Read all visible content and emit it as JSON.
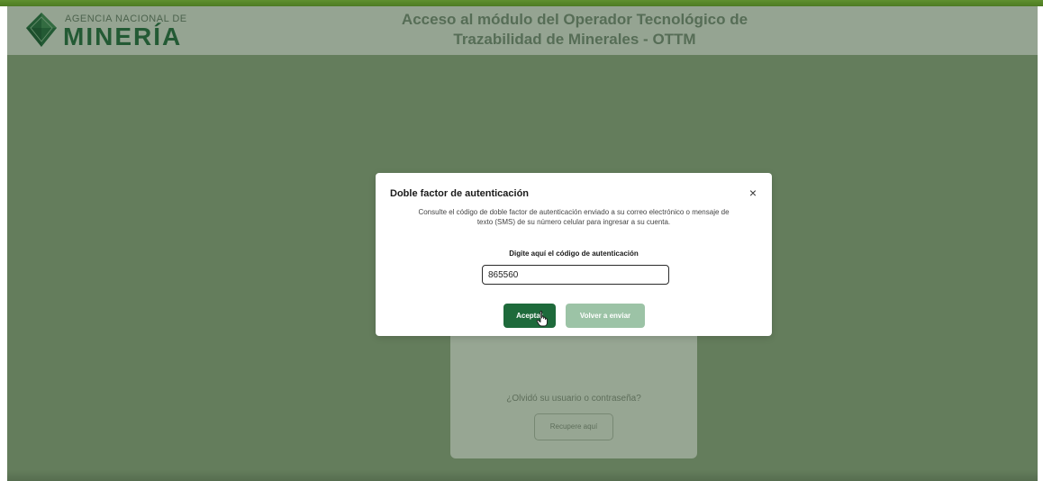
{
  "header": {
    "logo_top": "AGENCIA NACIONAL DE",
    "logo_main": "MINERÍA",
    "title_line1": "Acceso al módulo del Operador Tecnológico de",
    "title_line2": "Trazabilidad de Minerales - OTTM"
  },
  "login_card": {
    "forgot_text": "¿Olvidó su usuario o contraseña?",
    "recover_label": "Recupere aquí"
  },
  "modal": {
    "title": "Doble factor de autenticación",
    "close_glyph": "×",
    "description": "Consulte el código de doble factor de autenticación enviado a su correo electrónico o mensaje de texto (SMS) de su número celular para ingresar a su cuenta.",
    "code_label": "Digite aquí el código de autenticación",
    "code_value": "865560",
    "accept_label": "Aceptar",
    "resend_label": "Volver a enviar"
  },
  "colors": {
    "brand_green": "#1e6a3b",
    "resend_green_disabled": "#9cc3a6",
    "logo_green": "#1f6a46",
    "overlay": "#96a98f"
  },
  "icons": {
    "logo_mark": "diamond-logo-icon",
    "close": "close-icon",
    "cursor": "hand-pointer-icon"
  }
}
